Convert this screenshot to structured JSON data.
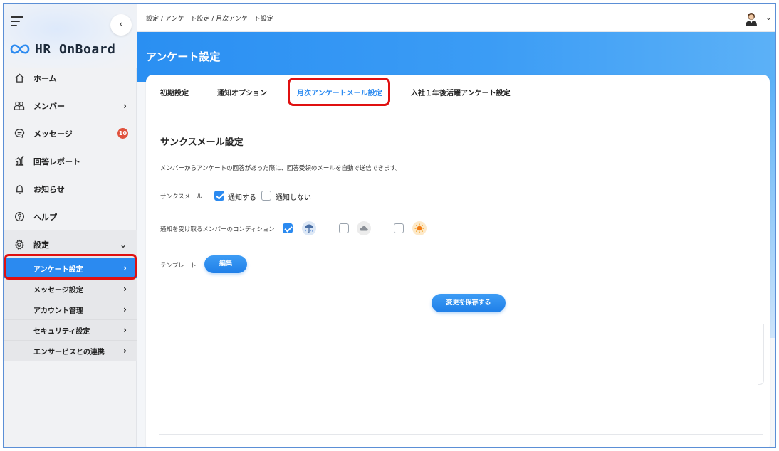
{
  "app": {
    "name": "HR OnBoard"
  },
  "sidebar": {
    "collapse_icon": "‹",
    "items": [
      {
        "label": "ホーム",
        "icon": "home-icon"
      },
      {
        "label": "メンバー",
        "icon": "members-icon",
        "chevron": "›"
      },
      {
        "label": "メッセージ",
        "icon": "message-icon",
        "badge": "10"
      },
      {
        "label": "回答レポート",
        "icon": "report-icon"
      },
      {
        "label": "お知らせ",
        "icon": "bell-icon"
      },
      {
        "label": "ヘルプ",
        "icon": "help-icon"
      },
      {
        "label": "設定",
        "icon": "gear-icon",
        "chevron": "⌄"
      }
    ],
    "sub_items": [
      {
        "label": "アンケート設定",
        "active": true
      },
      {
        "label": "メッセージ設定"
      },
      {
        "label": "アカウント管理"
      },
      {
        "label": "セキュリティ設定"
      },
      {
        "label": "エンサービスとの連携"
      }
    ]
  },
  "header": {
    "breadcrumb": "設定 / アンケート設定 / 月次アンケート設定",
    "avatar_chevron": "⌄"
  },
  "banner": {
    "title": "アンケート設定"
  },
  "tabs": [
    {
      "label": "初期設定"
    },
    {
      "label": "通知オプション"
    },
    {
      "label": "月次アンケートメール設定",
      "active": true
    },
    {
      "label": "入社１年後活躍アンケート設定"
    }
  ],
  "content": {
    "section_title": "サンクスメール設定",
    "description": "メンバーからアンケートの回答があった際に、回答受領のメールを自動で送信できます。",
    "thanks_mail": {
      "label": "サンクスメール",
      "options": [
        {
          "label": "通知する",
          "checked": true
        },
        {
          "label": "通知しない",
          "checked": false
        }
      ]
    },
    "condition": {
      "label": "通知を受け取るメンバーのコンディション",
      "options": [
        {
          "icon": "rain-icon",
          "checked": true
        },
        {
          "icon": "cloud-icon",
          "checked": false
        },
        {
          "icon": "sun-icon",
          "checked": false
        }
      ]
    },
    "template": {
      "label": "テンプレート",
      "edit_button": "編集"
    },
    "save_button": "変更を保存する"
  },
  "colors": {
    "accent": "#2b8af0",
    "highlight": "#e01010",
    "badge": "#e0513c"
  }
}
